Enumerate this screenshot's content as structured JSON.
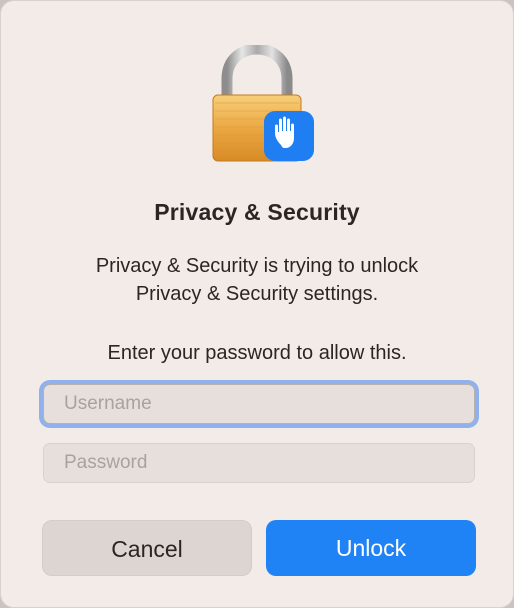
{
  "dialog": {
    "title": "Privacy & Security",
    "message_line1": "Privacy & Security is trying to unlock",
    "message_line2": "Privacy & Security settings.",
    "prompt": "Enter your password to allow this.",
    "username_placeholder": "Username",
    "password_placeholder": "Password",
    "cancel_label": "Cancel",
    "unlock_label": "Unlock"
  },
  "icons": {
    "lock": "padlock-icon",
    "badge": "raised-hand-icon"
  },
  "colors": {
    "dialog_background": "#f2ebe7",
    "accent": "#1f83f5",
    "focus_ring": "#8fb2ec",
    "lock_gold": "#e9a63b"
  }
}
